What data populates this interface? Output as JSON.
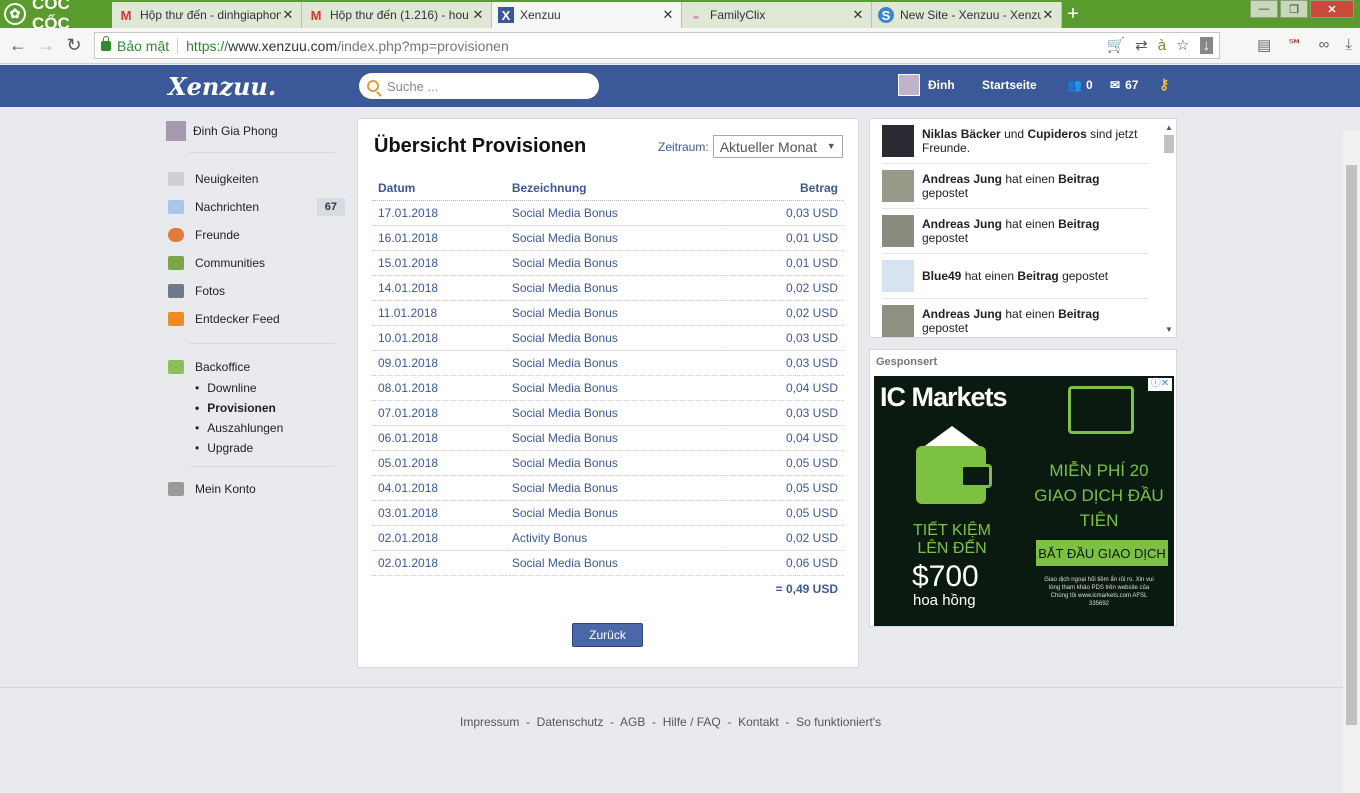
{
  "browser": {
    "brand": "CỐC CỐC",
    "tabs": [
      {
        "title": "Hộp thư đến - dinhgiaphong",
        "icon": "gmail-icon"
      },
      {
        "title": "Hộp thư đến (1.216) - hou",
        "icon": "gmail-icon"
      },
      {
        "title": "Xenzuu",
        "icon": "xenzuu-icon"
      },
      {
        "title": "FamilyClix",
        "icon": "familyclix-icon"
      },
      {
        "title": "New Site - Xenzuu - Xenzuu",
        "icon": "site-icon"
      }
    ],
    "secure_label": "Bảo mật",
    "url_proto": "https://",
    "url_host": "www.xenzuu.com",
    "url_rest": "/index.php?mp=provisionen"
  },
  "topnav": {
    "logo": "Xenzuu.",
    "search_placeholder": "Suche ...",
    "user": "Đinh",
    "home": "Startseite",
    "friend_count": "0",
    "message_count": "67"
  },
  "sidebar": {
    "username": "Đinh Gia Phong",
    "items": [
      {
        "label": "Neuigkeiten",
        "icon": "tag-icon"
      },
      {
        "label": "Nachrichten",
        "icon": "chat-icon",
        "count": "67"
      },
      {
        "label": "Freunde",
        "icon": "person-icon"
      },
      {
        "label": "Communities",
        "icon": "group-icon"
      },
      {
        "label": "Fotos",
        "icon": "camera-icon"
      },
      {
        "label": "Entdecker Feed",
        "icon": "rss-icon"
      }
    ],
    "backoffice": "Backoffice",
    "sub": [
      "Downline",
      "Provisionen",
      "Auszahlungen",
      "Upgrade"
    ],
    "konto": "Mein Konto"
  },
  "main": {
    "title": "Übersicht Provisionen",
    "zeitraum_label": "Zeitraum:",
    "zeitraum_value": "Aktueller Monat",
    "headers": [
      "Datum",
      "Bezeichnung",
      "Betrag"
    ],
    "rows": [
      [
        "17.01.2018",
        "Social Media Bonus",
        "0,03 USD"
      ],
      [
        "16.01.2018",
        "Social Media Bonus",
        "0,01 USD"
      ],
      [
        "15.01.2018",
        "Social Media Bonus",
        "0,01 USD"
      ],
      [
        "14.01.2018",
        "Social Media Bonus",
        "0,02 USD"
      ],
      [
        "11.01.2018",
        "Social Media Bonus",
        "0,02 USD"
      ],
      [
        "10.01.2018",
        "Social Media Bonus",
        "0,03 USD"
      ],
      [
        "09.01.2018",
        "Social Media Bonus",
        "0,03 USD"
      ],
      [
        "08.01.2018",
        "Social Media Bonus",
        "0,04 USD"
      ],
      [
        "07.01.2018",
        "Social Media Bonus",
        "0,03 USD"
      ],
      [
        "06.01.2018",
        "Social Media Bonus",
        "0,04 USD"
      ],
      [
        "05.01.2018",
        "Social Media Bonus",
        "0,05 USD"
      ],
      [
        "04.01.2018",
        "Social Media Bonus",
        "0,05 USD"
      ],
      [
        "03.01.2018",
        "Social Media Bonus",
        "0,05 USD"
      ],
      [
        "02.01.2018",
        "Activity Bonus",
        "0,02 USD"
      ],
      [
        "02.01.2018",
        "Social Media Bonus",
        "0,06 USD"
      ]
    ],
    "total": "= 0,49 USD",
    "back_button": "Zurück"
  },
  "feed": [
    {
      "name": "Niklas Bäcker",
      "mid": " und ",
      "name2": "Cupideros",
      "rest": " sind jetzt Freunde."
    },
    {
      "name": "Andreas Jung",
      "mid": " hat einen ",
      "name2": "Beitrag",
      "rest": " gepostet"
    },
    {
      "name": "Andreas Jung",
      "mid": " hat einen ",
      "name2": "Beitrag",
      "rest": " gepostet"
    },
    {
      "name": "Blue49",
      "mid": " hat einen ",
      "name2": "Beitrag",
      "rest": " gepostet"
    },
    {
      "name": "Andreas Jung",
      "mid": " hat einen ",
      "name2": "Beitrag",
      "rest": " gepostet"
    }
  ],
  "sponsor": {
    "label": "Gesponsert",
    "ad_brand": "IC Markets",
    "ad_l1": "TIẾT KIỆM LÊN ĐẾN",
    "ad_big": "$700",
    "ad_hh": "hoa hồng",
    "ad_free": "MIỄN PHÍ 20 GIAO DỊCH ĐẦU TIÊN",
    "ad_cta": "BẮT ĐẦU GIAO DỊCH",
    "ad_fine": "Giao dịch ngoại hối tiềm ẩn rủi ro. Xin vui lòng tham khảo PDS trên website của Chúng tôi www.icmarkets.com AFSL 335692"
  },
  "footer": {
    "links": "Impressum  -  Datenschutz  -  AGB  -  Hilfe / FAQ  -  Kontakt  -  So funktioniert's"
  }
}
